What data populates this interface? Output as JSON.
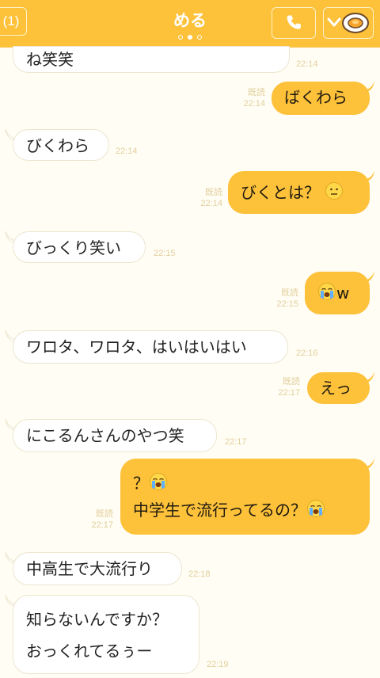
{
  "header": {
    "back_label": "(1)",
    "title": "める",
    "page_indicator": {
      "count": 3,
      "active": 1
    }
  },
  "colors": {
    "accent": "#fdc13a",
    "background": "#fffdf4",
    "incoming_bubble": "#ffffff",
    "meta_text": "#e2cf9c"
  },
  "messages": [
    {
      "dir": "in",
      "text": "ね笑笑",
      "time": "22:14"
    },
    {
      "dir": "out",
      "text": "ばくわら",
      "read": "既読",
      "time": "22:14"
    },
    {
      "dir": "in",
      "text": "びくわら",
      "time": "22:14"
    },
    {
      "dir": "out",
      "text": "びくとは？",
      "emoji": "neutral-face",
      "read": "既読",
      "time": "22:14"
    },
    {
      "dir": "in",
      "text": "びっくり笑い",
      "time": "22:15"
    },
    {
      "dir": "out",
      "text": "w",
      "emoji": "crying-face",
      "read": "既読",
      "time": "22:15"
    },
    {
      "dir": "in",
      "text": "ワロタ、ワロタ、はいはいはい",
      "time": "22:16"
    },
    {
      "dir": "out",
      "text": "えっ",
      "read": "既読",
      "time": "22:17"
    },
    {
      "dir": "in",
      "text": "にこるんさんのやつ笑",
      "time": "22:17"
    },
    {
      "dir": "out",
      "line1": "？",
      "line2": "中学生で流行ってるの？",
      "emoji": "crying-face",
      "read": "既読",
      "time": "22:17"
    },
    {
      "dir": "in",
      "text": "中高生で大流行り",
      "time": "22:18"
    },
    {
      "dir": "in",
      "line1": "知らないんですか？",
      "line2": "おっくれてるぅー",
      "time": "22:19"
    }
  ]
}
